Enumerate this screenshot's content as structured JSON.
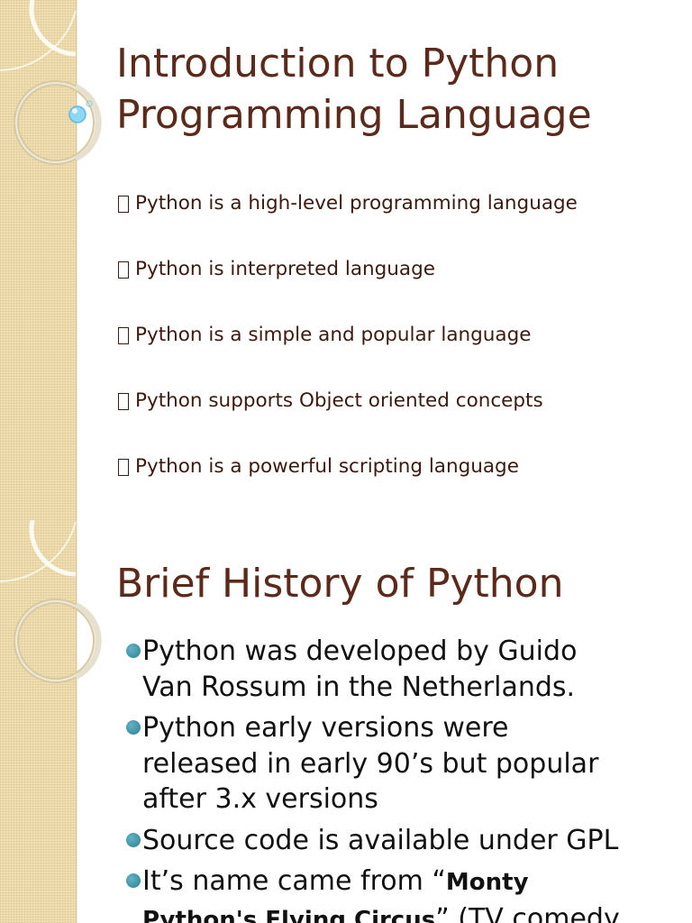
{
  "slides": [
    {
      "title_lines": [
        "Introduction to Python",
        "Programming Language"
      ],
      "points": [
        "Python is a high-level programming language",
        "Python is interpreted language",
        "Python is a simple and popular language",
        "Python supports Object oriented concepts",
        "Python is a powerful scripting language"
      ]
    },
    {
      "title": "Brief History of Python",
      "bullets": [
        {
          "lines": [
            "Python was developed by Guido",
            "Van Rossum in the Netherlands."
          ]
        },
        {
          "lines": [
            "Python early versions were",
            "released in early 90’s but popular",
            "after 3.x versions"
          ]
        },
        {
          "lines": [
            "Source code is available under GPL"
          ]
        },
        {
          "line1_prefix": "It’s name came from “",
          "line1_bold": "Monty",
          "line2_bold": "Python's Flying Circus",
          "line2_rest": "” (TV comedy"
        }
      ]
    }
  ],
  "colors": {
    "title": "#5b2a1a",
    "point_text": "#3b1a10",
    "bullet_text": "#111111",
    "bullet_dot": "#2f7f93",
    "strip": "#efdfb3",
    "orb": "#7fd0f0"
  },
  "icons": {
    "point_marker": "missing-glyph-box-icon",
    "bullet_marker": "teal-dot-icon"
  }
}
